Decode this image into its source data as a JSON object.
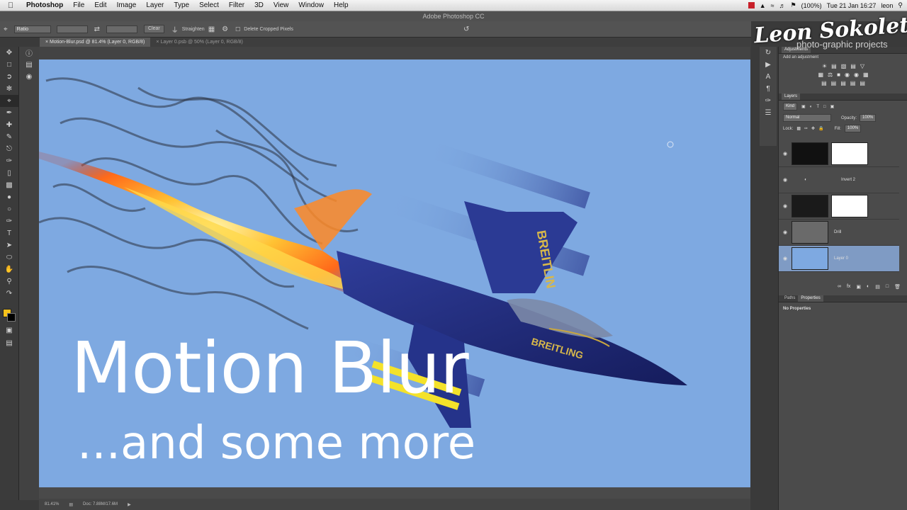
{
  "menubar": {
    "apple": "",
    "app": "Photoshop",
    "items": [
      "File",
      "Edit",
      "Image",
      "Layer",
      "Type",
      "Select",
      "Filter",
      "3D",
      "View",
      "Window",
      "Help"
    ],
    "battery": "(100%)",
    "clock": "Tue 21 Jan  16:27",
    "user": "leon",
    "search_icon": "search-icon"
  },
  "window": {
    "title": "Adobe Photoshop CC"
  },
  "options": {
    "ratio": "Ratio",
    "clear": "Clear",
    "straighten": "Straighten",
    "delete_cropped": "Delete Cropped Pixels"
  },
  "tabs": [
    {
      "label": "Motion-Blur.psd @ 81.4% (Layer 0, RGB/8)",
      "close": "×"
    },
    {
      "label": "Layer 0.psb @ 50% (Layer 0, RGB/8)",
      "close": "×"
    }
  ],
  "canvas": {
    "headline": "Motion Blur",
    "subline": "...and some more",
    "plane_text_1": "BREITLIN",
    "plane_text_2": "BREITLING"
  },
  "statusbar": {
    "zoom": "81.41%",
    "doc": "Doc: 7.88M/17.6M"
  },
  "panels": {
    "adjustments_tab": "Adjustments",
    "add_adjustment": "Add an adjustment",
    "layers_tab": "Layers",
    "kind": "Kind",
    "blend_mode": "Normal",
    "opacity_label": "Opacity:",
    "opacity_value": "100%",
    "lock_label": "Lock:",
    "fill_label": "Fill:",
    "fill_value": "100%",
    "paths_tab": "Paths",
    "properties_tab": "Properties",
    "no_properties": "No Properties"
  },
  "layers": [
    {
      "name": ""
    },
    {
      "name": "Invert 2"
    },
    {
      "name": ""
    },
    {
      "name": "Drill"
    },
    {
      "name": "Layer 0"
    }
  ],
  "watermark": {
    "name": "Leon Sokoletski",
    "tagline": "photo-graphic projects"
  },
  "colors": {
    "foreground": "#f7c21a",
    "background": "#000000",
    "sky": "#7ea9e1"
  }
}
